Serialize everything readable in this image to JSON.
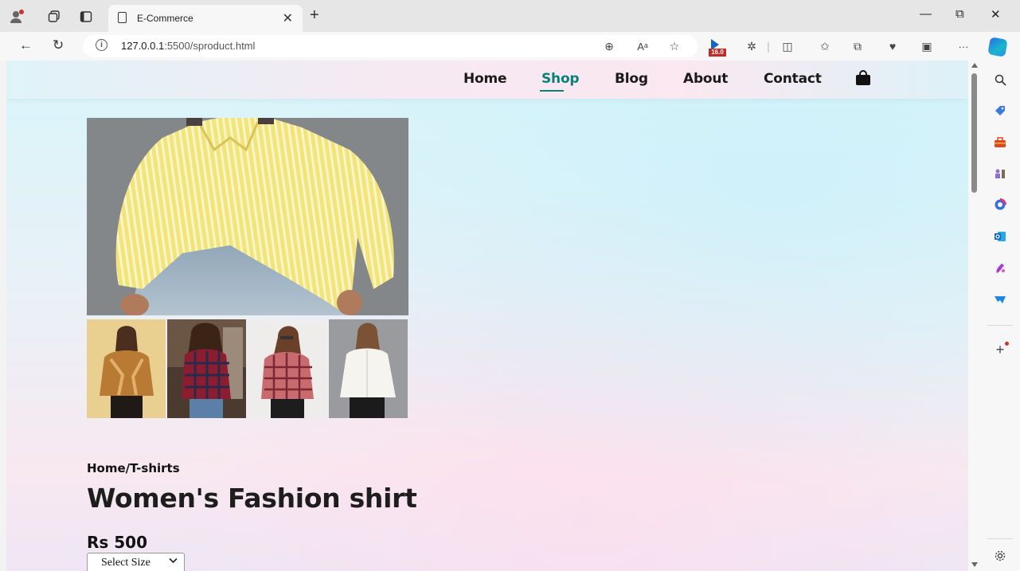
{
  "browser": {
    "tab_title": "E-Commerce",
    "tab_close": "✕",
    "new_tab": "+",
    "url_host": "127.0.0.1",
    "url_path": ":5500/sproduct.html",
    "extension_badge": "16.0",
    "window_controls": {
      "minimize": "—",
      "restore": "⧉",
      "close": "✕"
    },
    "more": "···"
  },
  "site": {
    "nav": {
      "home": "Home",
      "shop": "Shop",
      "blog": "Blog",
      "about": "About",
      "contact": "Contact"
    },
    "accent_color": "#088178"
  },
  "product": {
    "breadcrumb": "Home/T-shirts",
    "title": "Women's Fashion shirt",
    "price": "Rs 500",
    "size_select": "Select Size"
  }
}
